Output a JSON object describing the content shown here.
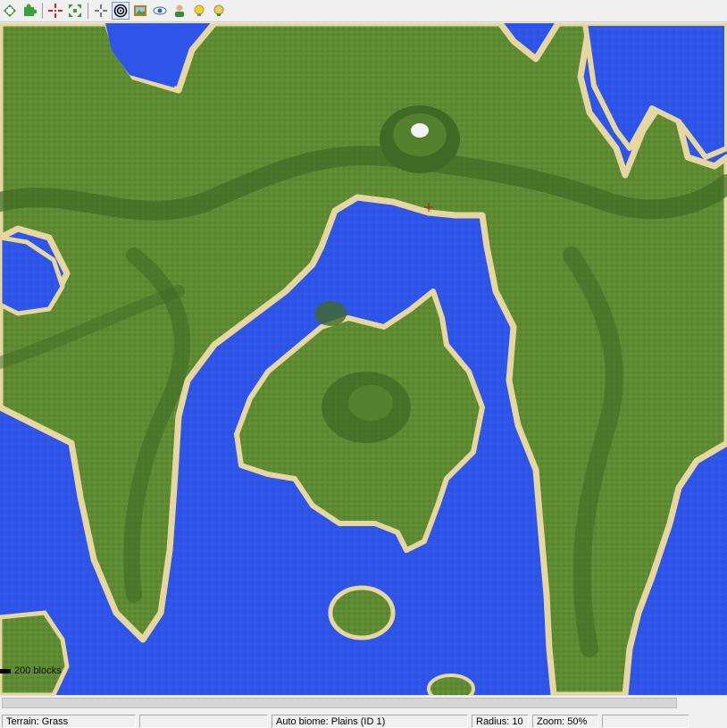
{
  "toolbar": {
    "buttons": [
      {
        "name": "zoom-in",
        "color": "#3aa13a"
      },
      {
        "name": "puzzle",
        "color": "#3aa13a"
      },
      {
        "name": "move-to-spawn",
        "color": "#d22020"
      },
      {
        "name": "fit-to-screen",
        "color": "#3aa13a"
      },
      {
        "name": "crosshair",
        "color": "#000000"
      },
      {
        "name": "target",
        "color": "#000000"
      },
      {
        "name": "picture",
        "color": "#c07a20"
      },
      {
        "name": "eye",
        "color": "#3060c0"
      },
      {
        "name": "user",
        "color": "#c07a20"
      },
      {
        "name": "lightbulb-on",
        "color": "#e8c020"
      },
      {
        "name": "lightbulb-off",
        "color": "#e8c020"
      }
    ]
  },
  "map": {
    "scale_label": "200 blocks",
    "colors": {
      "water": "#2f55e8",
      "land": "#5e8a33",
      "land_dark": "#45702a",
      "beach": "#e6d7a0",
      "snow": "#f4f4f4",
      "cursor": "#d01010"
    }
  },
  "status": {
    "terrain": "Terrain: Grass",
    "field2": "",
    "biome": "Auto biome: Plains (ID 1)",
    "radius": "Radius: 10",
    "zoom": "Zoom: 50%",
    "field6": ""
  }
}
